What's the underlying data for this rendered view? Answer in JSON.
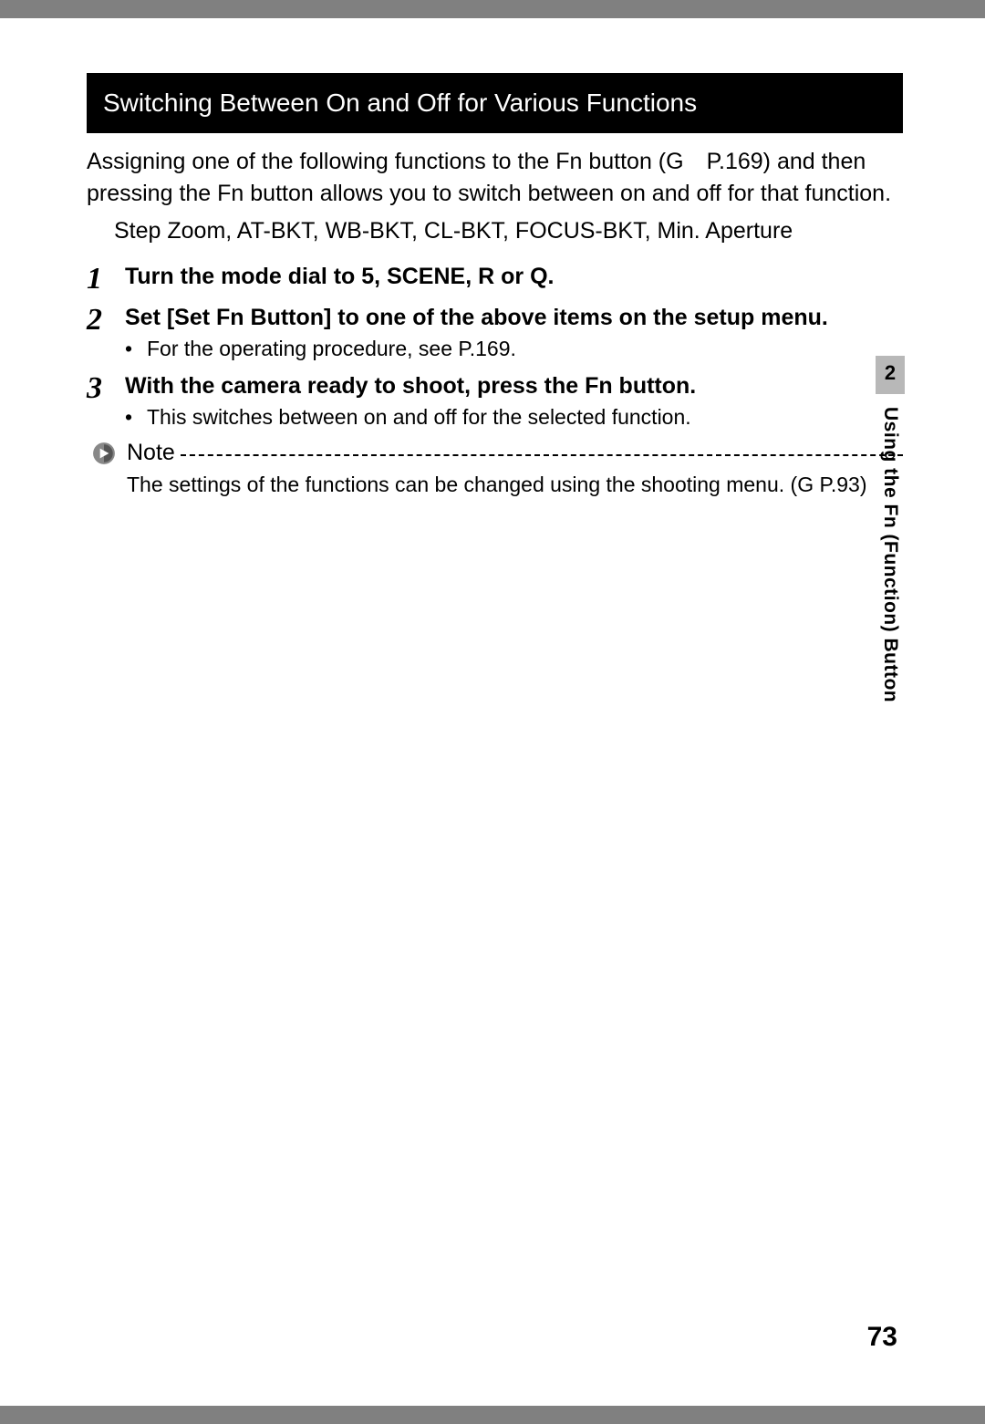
{
  "header": "Switching Between On and Off for Various Functions",
  "intro": "Assigning one of the following functions to the Fn button (G P.169) and then pressing the Fn button allows you to switch between on and off for that function.",
  "functions": "Step Zoom, AT-BKT, WB-BKT, CL-BKT, FOCUS-BKT, Min. Aperture",
  "steps": [
    {
      "num": "1",
      "title_parts": {
        "a": "Turn the mode dial to ",
        "b": "5",
        "c": ", SCENE, ",
        "d": "R",
        "e": " or ",
        "f": "Q",
        "g": "."
      },
      "sub": ""
    },
    {
      "num": "2",
      "title": "Set [Set Fn Button] to one of the above items on the setup menu.",
      "sub": "For the operating procedure, see P.169."
    },
    {
      "num": "3",
      "title": "With the camera ready to shoot, press the Fn button.",
      "sub": "This switches between on and off for the selected function."
    }
  ],
  "note": {
    "label": "Note",
    "text": "The settings of the functions can be changed using the shooting menu. (G P.93)"
  },
  "side": {
    "num": "2",
    "text": "Using the Fn (Function) Button"
  },
  "page_number": "73"
}
